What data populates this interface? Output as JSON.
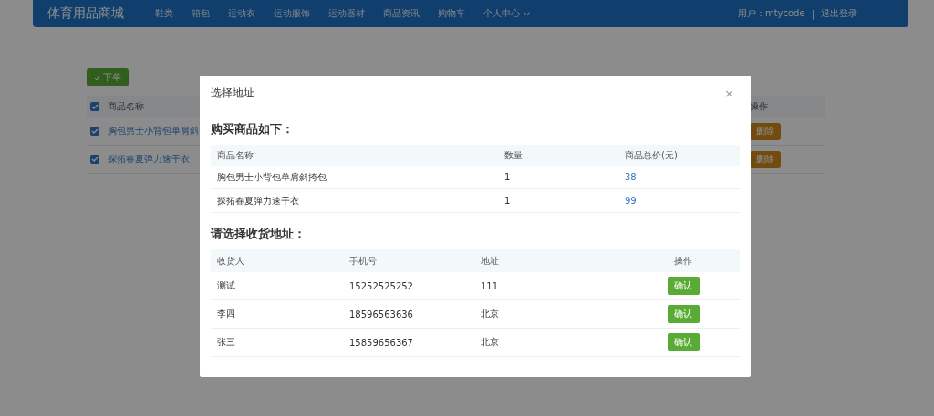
{
  "navbar": {
    "brand": "体育用品商城",
    "menu": [
      {
        "label": "鞋类",
        "dropdown": false
      },
      {
        "label": "箱包",
        "dropdown": false
      },
      {
        "label": "运动衣",
        "dropdown": false
      },
      {
        "label": "运动服饰",
        "dropdown": false
      },
      {
        "label": "运动器材",
        "dropdown": false
      },
      {
        "label": "商品资讯",
        "dropdown": false
      },
      {
        "label": "购物车",
        "dropdown": false
      },
      {
        "label": "个人中心",
        "dropdown": true
      }
    ],
    "user": "用户：mtycode",
    "separator": "|",
    "logout": "退出登录"
  },
  "background_page": {
    "order_button": "下单",
    "table": {
      "columns": [
        {
          "label": "商品名称"
        },
        {
          "label": "操作"
        }
      ],
      "header_checked": true,
      "rows": [
        {
          "checked": true,
          "name": "胸包男士小背包单肩斜",
          "action": "删除"
        },
        {
          "checked": true,
          "name": "探拓春夏弹力速干衣",
          "action": "删除"
        }
      ]
    }
  },
  "dialog": {
    "title": "选择地址",
    "close": "×",
    "goods_heading": "购买商品如下：",
    "goods_table": {
      "columns": [
        {
          "label": "商品名称"
        },
        {
          "label": "数量"
        },
        {
          "label": "商品总价(元)"
        }
      ],
      "rows": [
        {
          "name": "胸包男士小背包单肩斜挎包",
          "quantity": "1",
          "total": "38"
        },
        {
          "name": "探拓春夏弹力速干衣",
          "quantity": "1",
          "total": "99"
        }
      ]
    },
    "address_heading": "请选择收货地址：",
    "address_table": {
      "columns": [
        {
          "label": "收货人"
        },
        {
          "label": "手机号"
        },
        {
          "label": "地址"
        },
        {
          "label": "操作"
        }
      ],
      "rows": [
        {
          "receiver": "测试",
          "phone": "15252525252",
          "address": "111",
          "action": "确认"
        },
        {
          "receiver": "李四",
          "phone": "18596563636",
          "address": "北京",
          "action": "确认"
        },
        {
          "receiver": "张三",
          "phone": "15859656367",
          "address": "北京",
          "action": "确认"
        }
      ]
    }
  }
}
